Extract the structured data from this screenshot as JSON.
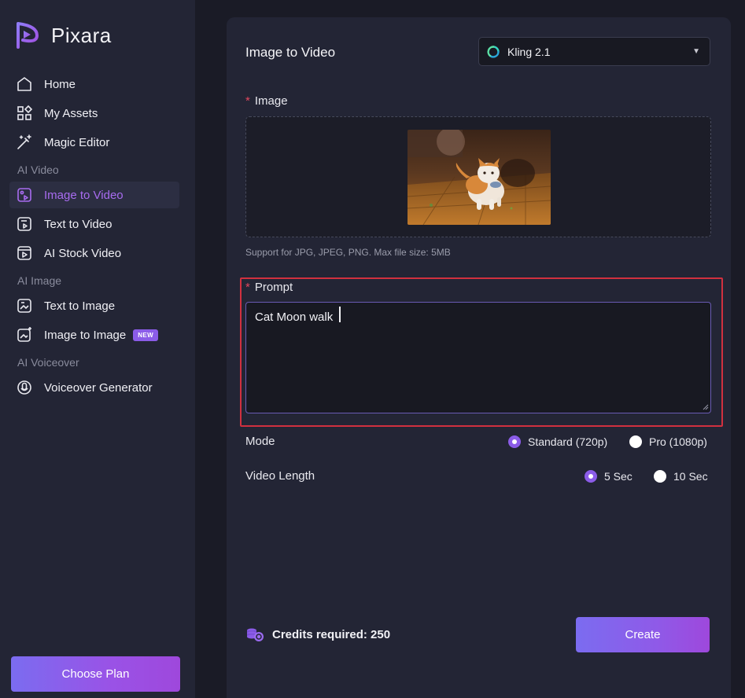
{
  "app": {
    "name": "Pixara"
  },
  "sidebar": {
    "items": [
      {
        "label": "Home",
        "icon": "home-icon"
      },
      {
        "label": "My Assets",
        "icon": "grid-icon"
      },
      {
        "label": "Magic Editor",
        "icon": "magic-wand-icon"
      },
      {
        "label": "Image to Video",
        "icon": "image-video-icon",
        "active": true
      },
      {
        "label": "Text to Video",
        "icon": "text-video-icon"
      },
      {
        "label": "AI Stock Video",
        "icon": "stock-video-icon"
      },
      {
        "label": "Text to Image",
        "icon": "text-image-icon"
      },
      {
        "label": "Image to Image",
        "icon": "image-image-icon",
        "badge": "NEW"
      },
      {
        "label": "Voiceover Generator",
        "icon": "microphone-icon"
      }
    ],
    "sections": [
      "AI Video",
      "AI Image",
      "AI Voiceover"
    ],
    "choose_plan": "Choose Plan"
  },
  "main": {
    "title": "Image to Video",
    "model": {
      "selected": "Kling 2.1",
      "icon": "kling-logo-icon"
    },
    "image_label": "Image",
    "required_mark": "*",
    "support_text": "Support for JPG, JPEG, PNG. Max file size: 5MB",
    "prompt_label": "Prompt",
    "prompt_value": "Cat Moon walk",
    "mode": {
      "label": "Mode",
      "options": [
        {
          "label": "Standard (720p)",
          "selected": true
        },
        {
          "label": "Pro (1080p)",
          "selected": false
        }
      ]
    },
    "video_length": {
      "label": "Video Length",
      "options": [
        {
          "label": "5 Sec",
          "selected": true
        },
        {
          "label": "10 Sec",
          "selected": false
        }
      ]
    },
    "credits_text": "Credits required: 250",
    "create_label": "Create"
  },
  "colors": {
    "accent": "#8b5ce8",
    "active_text": "#a86cf0",
    "highlight": "#d1303f",
    "background": "#1a1b26",
    "panel": "#232535"
  }
}
